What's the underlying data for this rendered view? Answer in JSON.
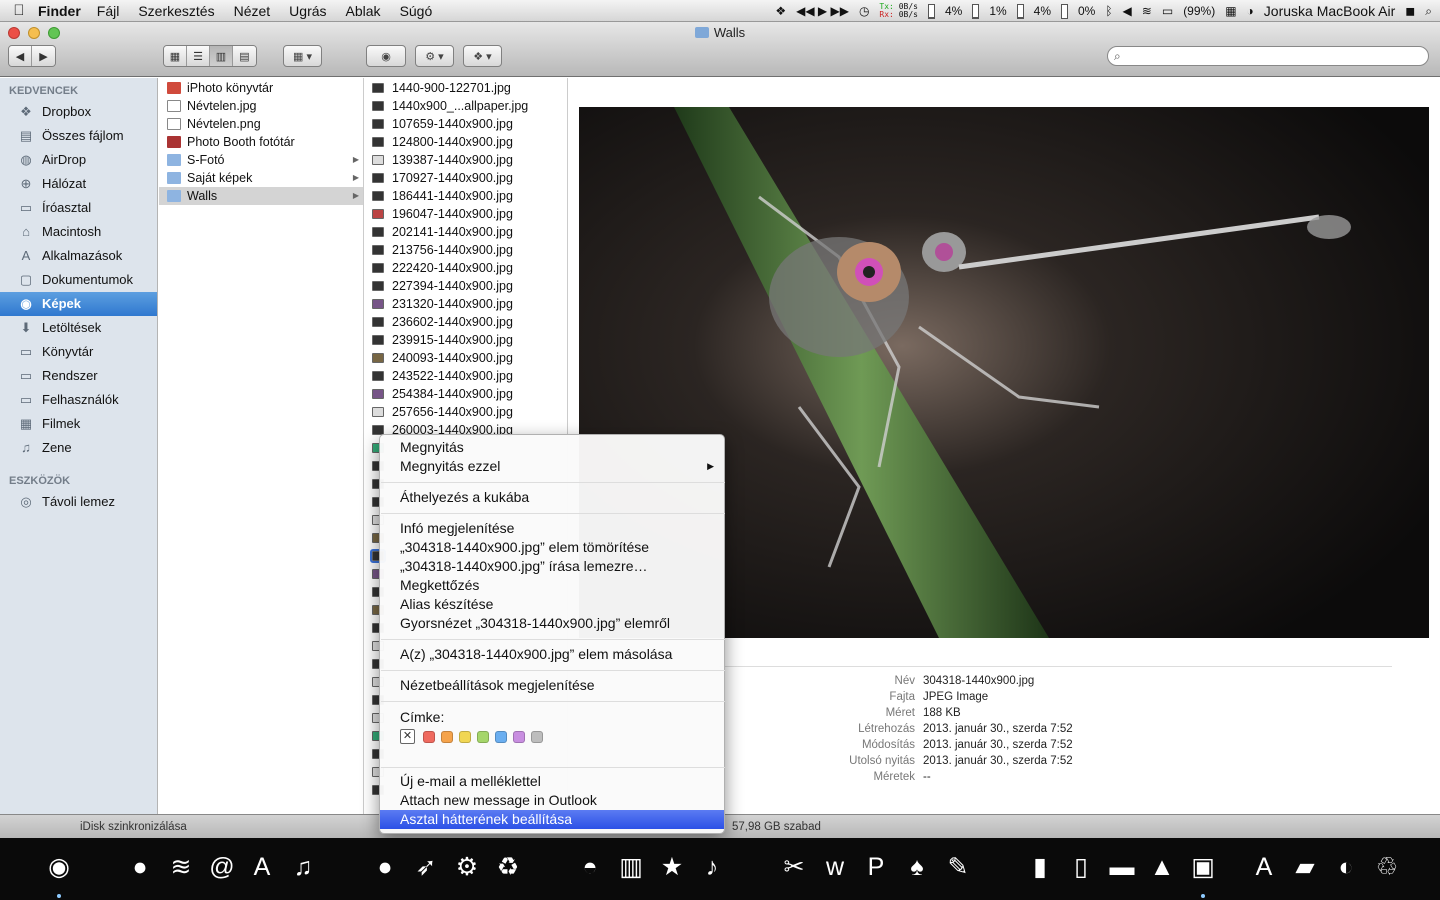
{
  "menubar": {
    "apple": "",
    "app": "Finder",
    "items": [
      "Fájl",
      "Szerkesztés",
      "Nézet",
      "Ugrás",
      "Ablak",
      "Súgó"
    ],
    "net_tx_label": "Tx:",
    "net_rx_label": "Rx:",
    "net_tx": "0B/s",
    "net_rx": "0B/s",
    "cpu": [
      {
        "value": "4%",
        "level": 0.04
      },
      {
        "value": "1%",
        "level": 0.01
      },
      {
        "value": "4%",
        "level": 0.04
      },
      {
        "value": "0%",
        "level": 0.0
      }
    ],
    "battery": "(99%)",
    "user": "Joruska MacBook Air",
    "media_controls": "◀◀ ▶ ▶▶"
  },
  "window": {
    "title": "Walls"
  },
  "sidebar": {
    "favorites_header": "KEDVENCEK",
    "favorites": [
      {
        "label": "Dropbox",
        "icon": "dropbox-icon",
        "glyph": "❖"
      },
      {
        "label": "Összes fájlom",
        "icon": "all-files-icon",
        "glyph": "▤"
      },
      {
        "label": "AirDrop",
        "icon": "airdrop-icon",
        "glyph": "◍"
      },
      {
        "label": "Hálózat",
        "icon": "network-icon",
        "glyph": "⊕"
      },
      {
        "label": "Íróasztal",
        "icon": "desktop-icon",
        "glyph": "▭"
      },
      {
        "label": "Macintosh",
        "icon": "home-icon",
        "glyph": "⌂"
      },
      {
        "label": "Alkalmazások",
        "icon": "applications-icon",
        "glyph": "A"
      },
      {
        "label": "Dokumentumok",
        "icon": "documents-icon",
        "glyph": "▢"
      },
      {
        "label": "Képek",
        "icon": "pictures-icon",
        "glyph": "◉",
        "selected": true
      },
      {
        "label": "Letöltések",
        "icon": "downloads-icon",
        "glyph": "⬇"
      },
      {
        "label": "Könyvtár",
        "icon": "folder-icon",
        "glyph": "▭"
      },
      {
        "label": "Rendszer",
        "icon": "folder-icon",
        "glyph": "▭"
      },
      {
        "label": "Felhasználók",
        "icon": "folder-icon",
        "glyph": "▭"
      },
      {
        "label": "Filmek",
        "icon": "movies-icon",
        "glyph": "▦"
      },
      {
        "label": "Zene",
        "icon": "music-icon",
        "glyph": "♫"
      }
    ],
    "devices_header": "ESZKÖZÖK",
    "devices": [
      {
        "label": "Távoli lemez",
        "icon": "disk-icon",
        "glyph": "◎"
      }
    ]
  },
  "column1": [
    {
      "label": "iPhoto könyvtár",
      "type": "photo"
    },
    {
      "label": "Névtelen.jpg",
      "type": "doc"
    },
    {
      "label": "Névtelen.png",
      "type": "doc"
    },
    {
      "label": "Photo Booth fotótár",
      "type": "booth"
    },
    {
      "label": "S-Fotó",
      "type": "folder",
      "arrow": true
    },
    {
      "label": "Saját képek",
      "type": "folder",
      "arrow": true
    },
    {
      "label": "Walls",
      "type": "folder",
      "arrow": true,
      "selected": true
    }
  ],
  "column2": [
    {
      "label": "1440-900-122701.jpg",
      "thumb": "thumb-dark"
    },
    {
      "label": "1440x900_...allpaper.jpg",
      "thumb": "thumb-dark"
    },
    {
      "label": "107659-1440x900.jpg",
      "thumb": "thumb-dark"
    },
    {
      "label": "124800-1440x900.jpg",
      "thumb": "thumb-dark"
    },
    {
      "label": "139387-1440x900.jpg",
      "thumb": "thumb-light"
    },
    {
      "label": "170927-1440x900.jpg",
      "thumb": "thumb-dark"
    },
    {
      "label": "186441-1440x900.jpg",
      "thumb": "thumb-dark"
    },
    {
      "label": "196047-1440x900.jpg",
      "thumb": "thumb-red"
    },
    {
      "label": "202141-1440x900.jpg",
      "thumb": "thumb-dark"
    },
    {
      "label": "213756-1440x900.jpg",
      "thumb": "thumb-dark"
    },
    {
      "label": "222420-1440x900.jpg",
      "thumb": "thumb-dark"
    },
    {
      "label": "227394-1440x900.jpg",
      "thumb": "thumb-dark"
    },
    {
      "label": "231320-1440x900.jpg",
      "thumb": "thumb-purple"
    },
    {
      "label": "236602-1440x900.jpg",
      "thumb": "thumb-dark"
    },
    {
      "label": "239915-1440x900.jpg",
      "thumb": "thumb-dark"
    },
    {
      "label": "240093-1440x900.jpg",
      "thumb": "thumb-brown"
    },
    {
      "label": "243522-1440x900.jpg",
      "thumb": "thumb-dark"
    },
    {
      "label": "254384-1440x900.jpg",
      "thumb": "thumb-purple"
    },
    {
      "label": "257656-1440x900.jpg",
      "thumb": "thumb-light"
    },
    {
      "label": "260003-1440x900.jpg",
      "thumb": "thumb-dark"
    },
    {
      "label": "",
      "thumb": "thumb-green"
    },
    {
      "label": "",
      "thumb": "thumb-dark"
    },
    {
      "label": "",
      "thumb": "thumb-dark"
    },
    {
      "label": "",
      "thumb": "thumb-dark"
    },
    {
      "label": "",
      "thumb": "thumb-light"
    },
    {
      "label": "",
      "thumb": "thumb-brown"
    },
    {
      "label": "",
      "thumb": "thumb-dark",
      "selected": true
    },
    {
      "label": "",
      "thumb": "thumb-purple"
    },
    {
      "label": "",
      "thumb": "thumb-dark"
    },
    {
      "label": "",
      "thumb": "thumb-brown"
    },
    {
      "label": "",
      "thumb": "thumb-dark"
    },
    {
      "label": "",
      "thumb": "thumb-light"
    },
    {
      "label": "",
      "thumb": "thumb-dark"
    },
    {
      "label": "",
      "thumb": "thumb-light"
    },
    {
      "label": "",
      "thumb": "thumb-dark"
    },
    {
      "label": "",
      "thumb": "thumb-light"
    },
    {
      "label": "",
      "thumb": "thumb-green"
    },
    {
      "label": "",
      "thumb": "thumb-dark"
    },
    {
      "label": "",
      "thumb": "thumb-light"
    },
    {
      "label": "",
      "thumb": "thumb-dark"
    }
  ],
  "preview": {
    "info": [
      {
        "key": "Név",
        "value": "304318-1440x900.jpg"
      },
      {
        "key": "Fajta",
        "value": "JPEG Image"
      },
      {
        "key": "Méret",
        "value": "188 KB"
      },
      {
        "key": "Létrehozás",
        "value": "2013. január 30., szerda 7:52"
      },
      {
        "key": "Módosítás",
        "value": "2013. január 30., szerda 7:52"
      },
      {
        "key": "Utolsó nyitás",
        "value": "2013. január 30., szerda 7:52"
      },
      {
        "key": "Méretek",
        "value": "--"
      }
    ]
  },
  "statusbar": {
    "left": "iDisk szinkronizálása",
    "free": "57,98 GB szabad"
  },
  "context_menu": {
    "open": "Megnyitás",
    "open_with": "Megnyitás ezzel",
    "trash": "Áthelyezés a kukába",
    "info": "Infó megjelenítése",
    "compress": "„304318-1440x900.jpg” elem tömörítése",
    "burn": "„304318-1440x900.jpg” írása lemezre…",
    "duplicate": "Megkettőzés",
    "alias": "Alias készítése",
    "quicklook": "Gyorsnézet „304318-1440x900.jpg” elemről",
    "copy": "A(z) „304318-1440x900.jpg” elem másolása",
    "view_options": "Nézetbeállítások megjelenítése",
    "label_title": "Címke:",
    "label_none": "✕",
    "label_colors": [
      "#ef6a5f",
      "#f5a34b",
      "#f1d653",
      "#a5d66a",
      "#6aaef0",
      "#c88ee0",
      "#bdbdbd"
    ],
    "email": "Új e-mail a melléklettel",
    "outlook": "Attach new message in Outlook",
    "set_desktop": "Asztal hátterének beállítása"
  },
  "dock": [
    {
      "icon": "finder-disc-icon",
      "glyph": "◉",
      "running": true
    },
    {
      "icon": "circle-icon",
      "glyph": "●"
    },
    {
      "icon": "wifi-icon",
      "glyph": "≋"
    },
    {
      "icon": "at-mail-icon",
      "glyph": "@"
    },
    {
      "icon": "app-store-icon",
      "glyph": "A"
    },
    {
      "icon": "headphones-icon",
      "glyph": "♫"
    },
    {
      "icon": "chat-bubble-icon",
      "glyph": "●"
    },
    {
      "icon": "bird-icon",
      "glyph": "➶"
    },
    {
      "icon": "gear-icon",
      "glyph": "⚙"
    },
    {
      "icon": "recycle-icon",
      "glyph": "♻"
    },
    {
      "icon": "podcast-icon",
      "glyph": "◓"
    },
    {
      "icon": "film-strip-icon",
      "glyph": "▥"
    },
    {
      "icon": "star-icon",
      "glyph": "★"
    },
    {
      "icon": "guitar-icon",
      "glyph": "♪"
    },
    {
      "icon": "scissors-icon",
      "glyph": "✂"
    },
    {
      "icon": "w-icon",
      "glyph": "w"
    },
    {
      "icon": "p-icon",
      "glyph": "P"
    },
    {
      "icon": "lamp-icon",
      "glyph": "♠"
    },
    {
      "icon": "pen-icon",
      "glyph": "✎"
    },
    {
      "icon": "notebook-icon",
      "glyph": "▮"
    },
    {
      "icon": "paper-icon",
      "glyph": "▯"
    },
    {
      "icon": "monitor-icon",
      "glyph": "▬"
    },
    {
      "icon": "podium-icon",
      "glyph": "▲"
    },
    {
      "icon": "preview-icon",
      "glyph": "▣",
      "running": true
    },
    {
      "icon": "apps-folder-icon",
      "glyph": "A"
    },
    {
      "icon": "folder-icon",
      "glyph": "▰"
    },
    {
      "icon": "sync-icon",
      "glyph": "◐"
    },
    {
      "icon": "trash-icon",
      "glyph": "♲"
    }
  ]
}
